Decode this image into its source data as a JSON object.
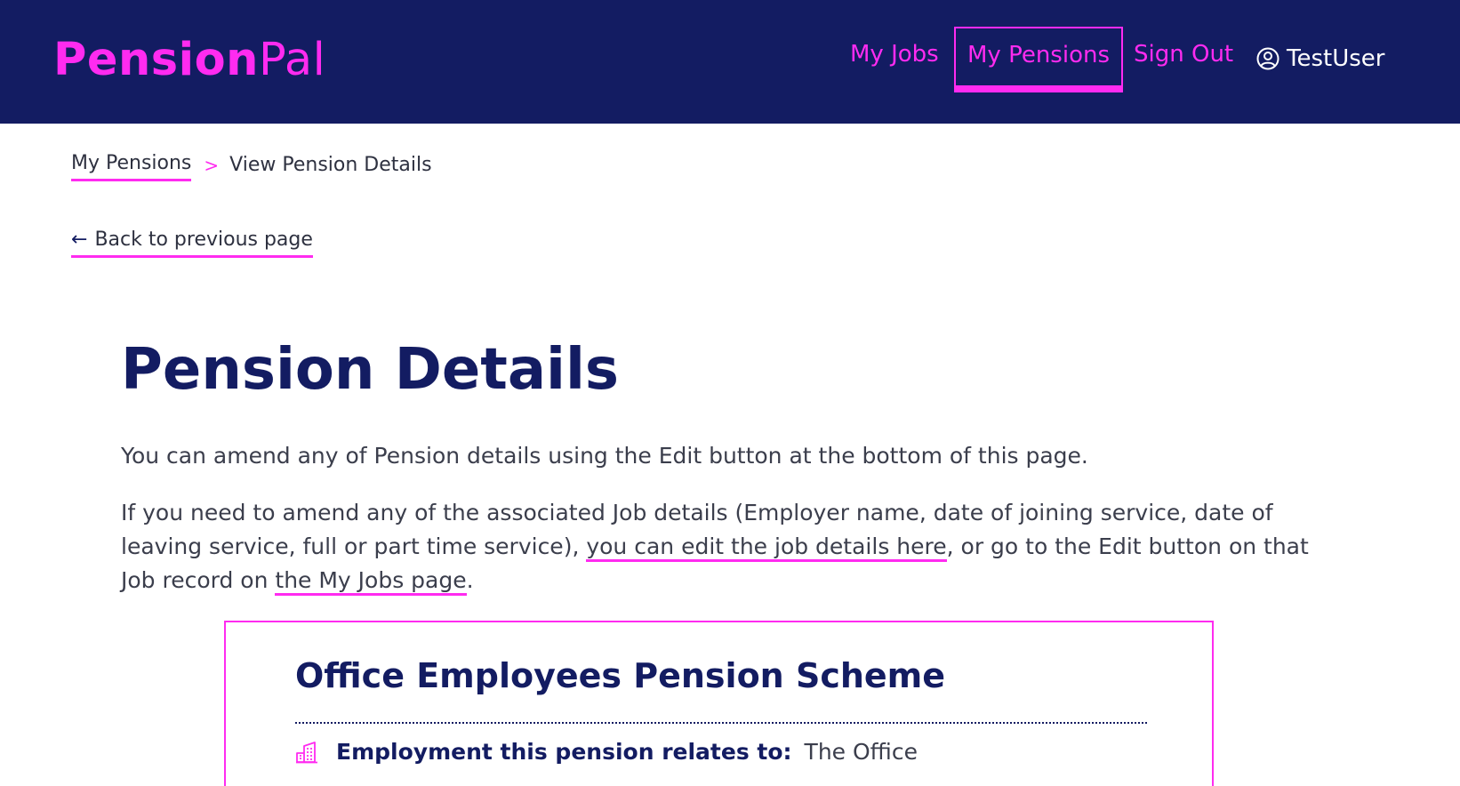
{
  "header": {
    "logo_bold": "Pension",
    "logo_light": "Pal",
    "nav": {
      "my_jobs": "My Jobs",
      "my_pensions": "My Pensions",
      "sign_out": "Sign Out"
    },
    "user": {
      "name": "TestUser",
      "icon": "user-circle-icon"
    }
  },
  "breadcrumb": {
    "parent": "My Pensions",
    "separator": ">",
    "current": "View Pension Details"
  },
  "back_link": {
    "arrow": "←",
    "label": "Back to previous page"
  },
  "main": {
    "title": "Pension Details",
    "para1": "You can amend any of Pension details using the Edit button at the bottom of this page.",
    "para2_part1": "If you need to amend any of the associated Job details (Employer name, date of joining service, date of leaving service, full or part time service), ",
    "para2_link1": "you can edit the job details here",
    "para2_part2": ", or go to the Edit button on that Job record on ",
    "para2_link2": "the My Jobs page",
    "para2_part3": "."
  },
  "card": {
    "scheme_name": "Office Employees Pension Scheme",
    "employment_label": "Employment this pension relates to:",
    "employment_value": "The Office",
    "employment_icon": "building-icon"
  },
  "colors": {
    "navy": "#131c62",
    "accent": "#ff2bf0",
    "text": "#3b3e4c"
  }
}
